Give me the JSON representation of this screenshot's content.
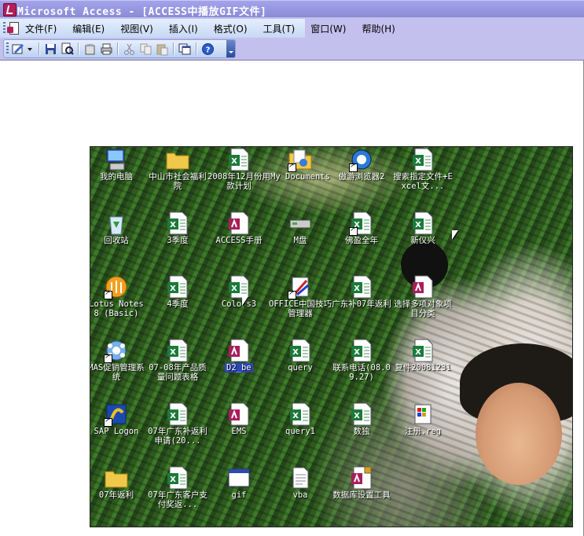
{
  "window": {
    "title": "Microsoft Access - [ACCESS中播放GIF文件]"
  },
  "menubar": {
    "items": [
      "文件(F)",
      "编辑(E)",
      "视图(V)",
      "插入(I)",
      "格式(O)",
      "工具(T)",
      "窗口(W)",
      "帮助(H)"
    ]
  },
  "toolbar": {
    "buttons": [
      "design-view",
      "save",
      "print-preview",
      "properties",
      "print",
      "cut",
      "copy",
      "paste",
      "new-window",
      "help"
    ]
  },
  "desktop_icons": [
    {
      "label": "我的电脑",
      "icon": "my-computer-icon"
    },
    {
      "label": "中山市社会福利院",
      "icon": "folder-icon"
    },
    {
      "label": "2008年12月份用款计划",
      "icon": "excel-file-icon"
    },
    {
      "label": "My Documents",
      "icon": "documents-folder-icon"
    },
    {
      "label": "傲游浏览器2",
      "icon": "browser-icon"
    },
    {
      "label": "搜索指定文件+Excel文...",
      "icon": "excel-file-icon"
    },
    {
      "label": "回收站",
      "icon": "recycle-bin-icon"
    },
    {
      "label": "3季度",
      "icon": "excel-file-icon"
    },
    {
      "label": "ACCESS手册",
      "icon": "access-file-icon"
    },
    {
      "label": "M盘",
      "icon": "drive-icon"
    },
    {
      "label": "佛盈全年",
      "icon": "excel-file-icon"
    },
    {
      "label": "新仪兴",
      "icon": "excel-file-icon"
    },
    {
      "label": "Lotus Notes 8 (Basic)",
      "icon": "lotus-notes-icon"
    },
    {
      "label": "4季度",
      "icon": "excel-file-icon"
    },
    {
      "label": "Colors3",
      "icon": "excel-file-icon"
    },
    {
      "label": "OFFICE中国技巧管理器",
      "icon": "office-tool-icon"
    },
    {
      "label": "广东补07年返利",
      "icon": "excel-file-icon"
    },
    {
      "label": "选择多项对象项目分类",
      "icon": "access-file-icon"
    },
    {
      "label": "MAS促销管理系统",
      "icon": "mas-icon"
    },
    {
      "label": "07-08年产品质量问题表格",
      "icon": "excel-file-icon"
    },
    {
      "label": "D2_be",
      "icon": "access-file-icon"
    },
    {
      "label": "query",
      "icon": "excel-file-icon"
    },
    {
      "label": "联系电话(08.09.27)",
      "icon": "excel-file-icon"
    },
    {
      "label": "复件20081231",
      "icon": "excel-file-icon"
    },
    {
      "label": "SAP Logon",
      "icon": "sap-icon"
    },
    {
      "label": "07年广东补返利申请(20...",
      "icon": "excel-file-icon"
    },
    {
      "label": "EMS",
      "icon": "access-file-icon"
    },
    {
      "label": "query1",
      "icon": "excel-file-icon"
    },
    {
      "label": "数独",
      "icon": "excel-file-icon"
    },
    {
      "label": "注册.reg",
      "icon": "registry-file-icon"
    },
    {
      "label": "07年返利",
      "icon": "folder-icon"
    },
    {
      "label": "07年广东客户支付奖返...",
      "icon": "excel-file-icon"
    },
    {
      "label": "gif",
      "icon": "window-app-icon"
    },
    {
      "label": "vba",
      "icon": "text-file-icon"
    },
    {
      "label": "数据库设置工具",
      "icon": "access-lock-icon"
    }
  ],
  "colors": {
    "title_bar": "#9c9ce6",
    "menu_bg": "#c4c0ee",
    "toolbar_bg": "#c8d8f4",
    "selection": "#2c46b8"
  }
}
